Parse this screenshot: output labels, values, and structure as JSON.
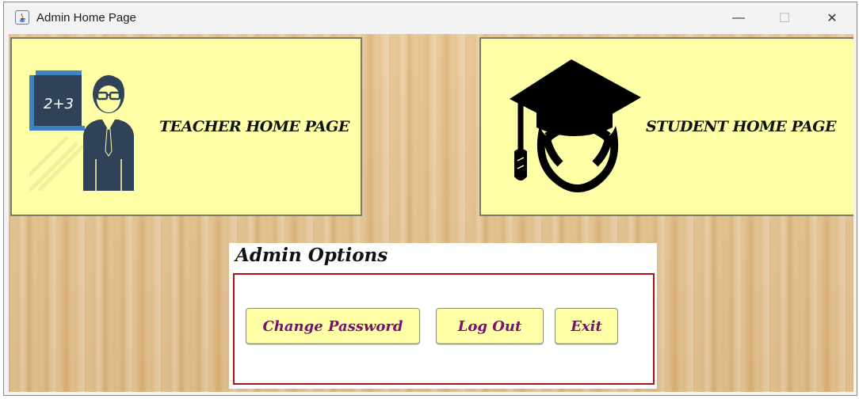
{
  "window": {
    "title": "Admin Home Page",
    "controls": {
      "minimize": "—",
      "maximize": "☐",
      "close": "✕"
    }
  },
  "cards": {
    "teacher": {
      "label": "TEACHER HOME PAGE",
      "icon": "teacher-icon"
    },
    "student": {
      "label": "STUDENT HOME PAGE",
      "icon": "graduate-icon"
    }
  },
  "admin": {
    "title": "Admin Options",
    "buttons": {
      "change_password": "Change Password",
      "log_out": "Log Out",
      "exit": "Exit"
    }
  },
  "colors": {
    "card_bg": "#ffffa8",
    "button_text": "#7a0f74",
    "admin_border": "#b0121b"
  }
}
